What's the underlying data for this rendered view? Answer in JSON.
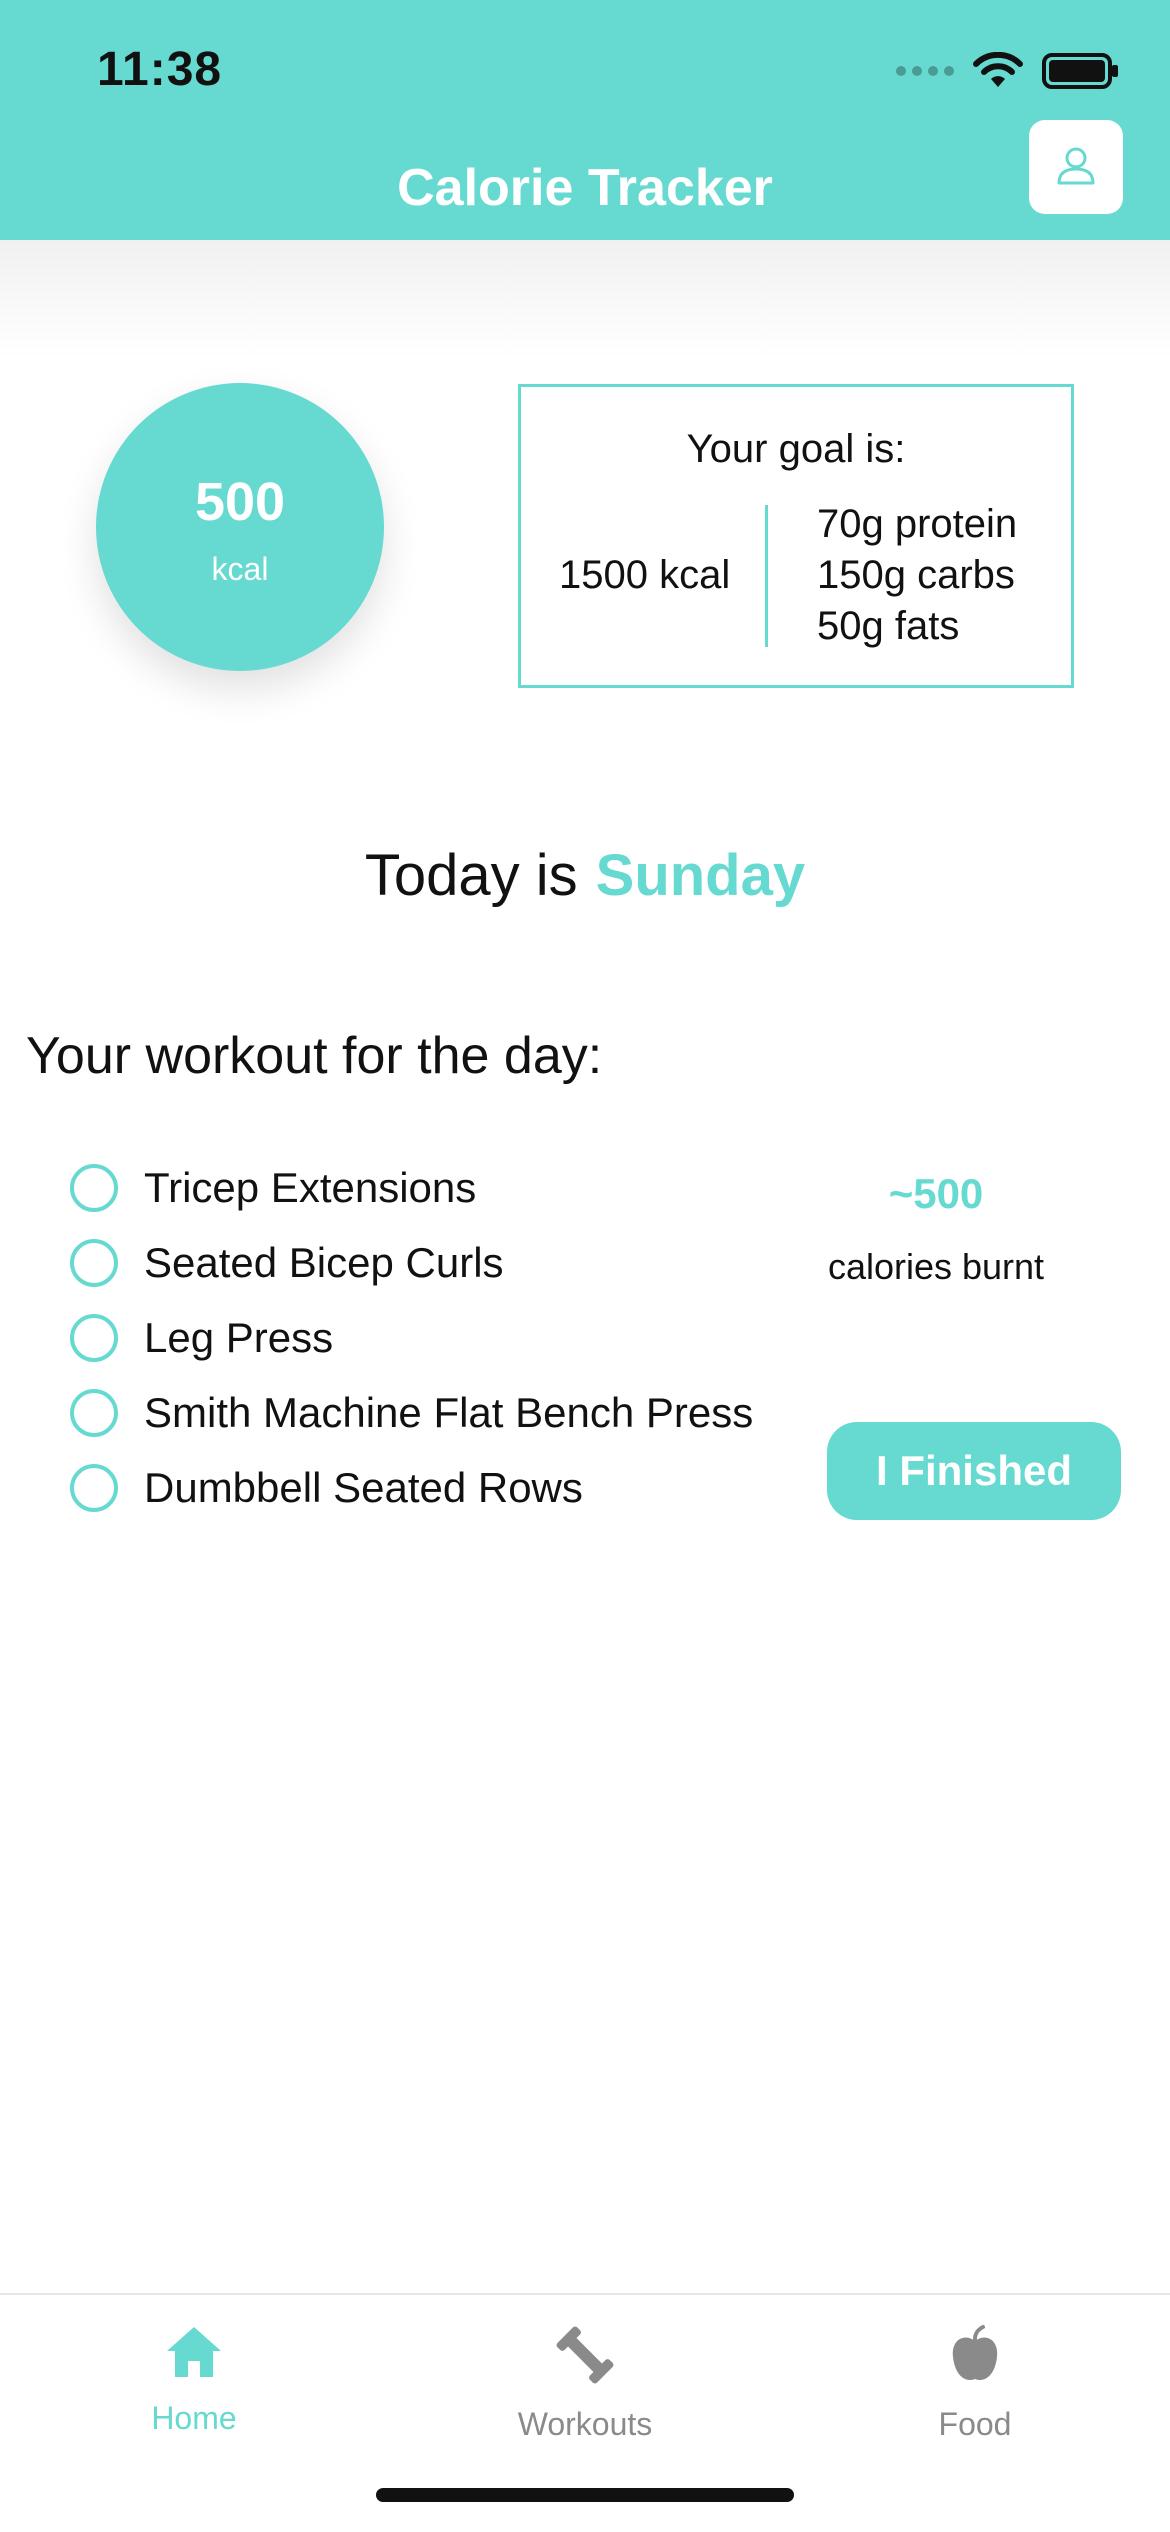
{
  "status_bar": {
    "time": "11:38",
    "icons": [
      "signal-icon",
      "wifi-icon",
      "battery-icon"
    ]
  },
  "header": {
    "title": "Calorie Tracker",
    "profile_icon": "user-icon"
  },
  "calories": {
    "value": "500",
    "unit": "kcal"
  },
  "goal": {
    "title": "Your goal is:",
    "kcal": "1500 kcal",
    "macros": [
      "70g protein",
      "150g carbs",
      "50g fats"
    ]
  },
  "today": {
    "prefix": "Today is",
    "day": "Sunday"
  },
  "workout": {
    "heading": "Your workout for the day:",
    "items": [
      "Tricep Extensions",
      "Seated Bicep Curls",
      "Leg Press",
      "Smith Machine Flat Bench Press",
      "Dumbbell Seated Rows"
    ],
    "burnt_value": "~500",
    "burnt_label": "calories burnt",
    "finish_button": "I Finished"
  },
  "tabs": [
    {
      "label": "Home",
      "icon": "home-icon",
      "active": true
    },
    {
      "label": "Workouts",
      "icon": "dumbbell-icon",
      "active": false
    },
    {
      "label": "Food",
      "icon": "apple-icon",
      "active": false
    }
  ],
  "colors": {
    "accent": "#66d9d0",
    "inactive": "#8a8a8a"
  }
}
